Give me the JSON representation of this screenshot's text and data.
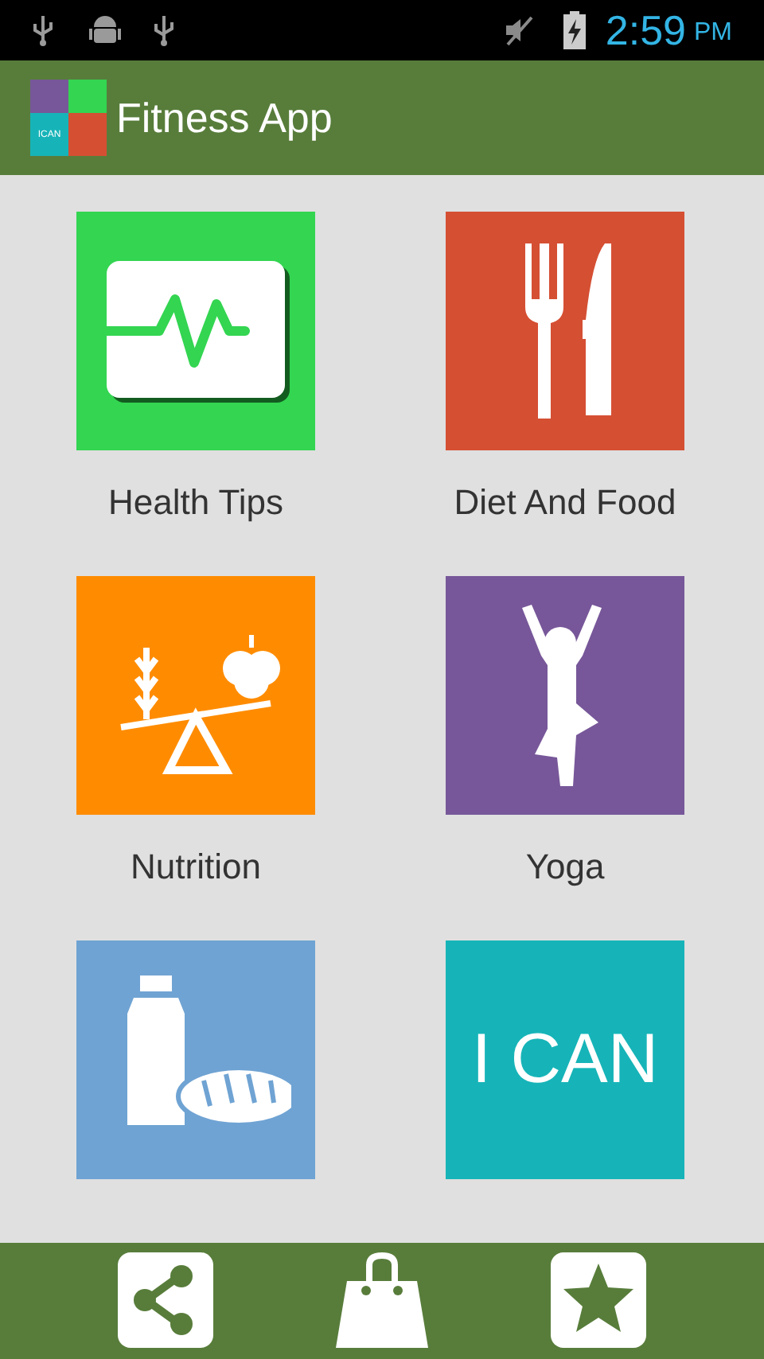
{
  "status_bar": {
    "time": "2:59",
    "ampm": "PM"
  },
  "app_bar": {
    "logo_text": "ICAN",
    "title": "Fitness App"
  },
  "tiles": [
    {
      "kind": "heart-monitor",
      "color": "#33d551",
      "label": "Health Tips"
    },
    {
      "kind": "cutlery",
      "color": "#d54f33",
      "label": "Diet And Food"
    },
    {
      "kind": "scale",
      "color": "#ff8c00",
      "label": "Nutrition"
    },
    {
      "kind": "yoga",
      "color": "#775799",
      "label": "Yoga"
    },
    {
      "kind": "bottle-bread",
      "color": "#6fa3d3"
    },
    {
      "kind": "text",
      "color": "#16b4b8",
      "text": "I CAN"
    }
  ],
  "bottom_bar": [
    {
      "kind": "share"
    },
    {
      "kind": "bag"
    },
    {
      "kind": "star"
    }
  ]
}
